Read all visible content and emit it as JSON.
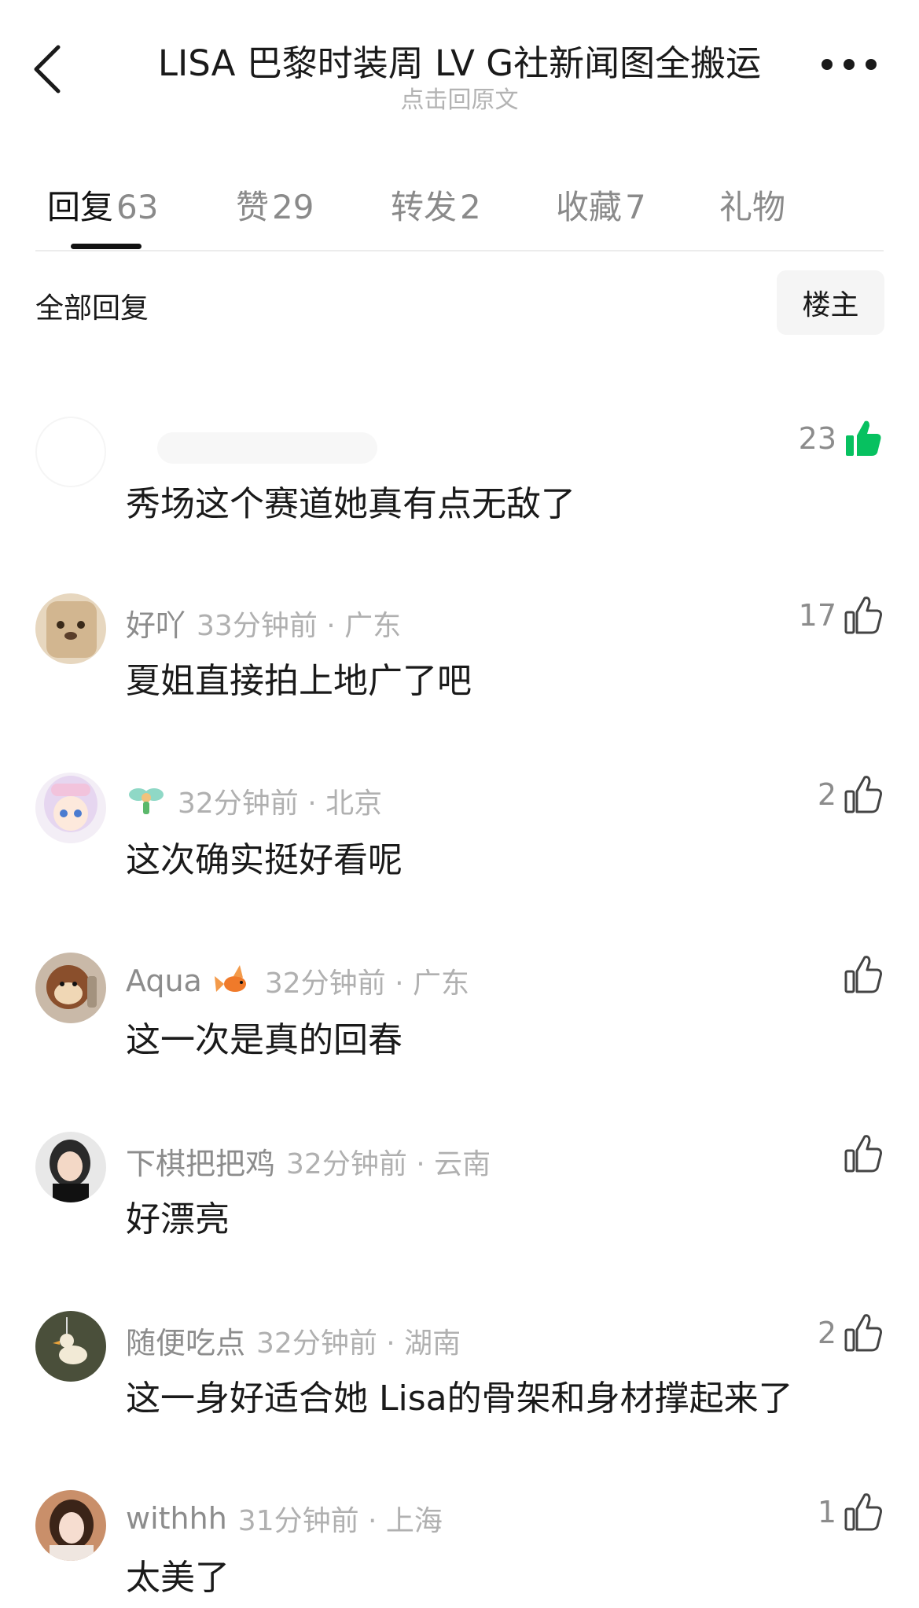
{
  "header": {
    "title": "LISA 巴黎时装周 LV G社新闻图全搬运",
    "subtitle": "点击回原文"
  },
  "tabs": [
    {
      "label": "回复",
      "count": "63"
    },
    {
      "label": "赞",
      "count": "29"
    },
    {
      "label": "转发",
      "count": "2"
    },
    {
      "label": "收藏",
      "count": "7"
    },
    {
      "label": "礼物",
      "count": ""
    }
  ],
  "filter": {
    "label": "全部回复",
    "op_button": "楼主"
  },
  "comments": [
    {
      "user": "",
      "time": "",
      "text": "秀场这个赛道她真有点无敌了",
      "likes": "23",
      "liked": true
    },
    {
      "user": "好吖",
      "time": "33分钟前 · 广东",
      "text": "夏姐直接拍上地广了吧",
      "likes": "17",
      "liked": false
    },
    {
      "user": "",
      "time": "32分钟前 · 北京",
      "text": "这次确实挺好看呢",
      "likes": "2",
      "liked": false
    },
    {
      "user": "Aqua",
      "time": "32分钟前 · 广东",
      "text": "这一次是真的回春",
      "likes": "",
      "liked": false
    },
    {
      "user": "下棋把把鸡",
      "time": "32分钟前 · 云南",
      "text": "好漂亮",
      "likes": "",
      "liked": false
    },
    {
      "user": "随便吃点",
      "time": "32分钟前 · 湖南",
      "text": "这一身好适合她 Lisa的骨架和身材撑起来了",
      "likes": "2",
      "liked": false
    },
    {
      "user": "withhh",
      "time": "31分钟前 · 上海",
      "text": "太美了",
      "likes": "1",
      "liked": false
    }
  ],
  "colors": {
    "accent_green": "#07c160",
    "text_primary": "#1a1a1a",
    "text_secondary": "#8c8c8c"
  }
}
